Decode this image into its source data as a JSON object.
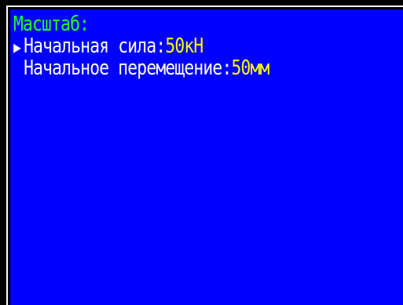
{
  "colors": {
    "background": "#0000fe",
    "frame": "#000000",
    "title": "#22ff22",
    "label": "#ffffff",
    "value": "#ffff00"
  },
  "screen": {
    "title": "Масштаб:",
    "cursor_icon": "triangle-right-icon",
    "items": [
      {
        "label": "Начальная сила:",
        "value": "50кН",
        "selected": true
      },
      {
        "label": "Начальное перемещение:",
        "value": "50мм",
        "selected": false
      }
    ]
  }
}
